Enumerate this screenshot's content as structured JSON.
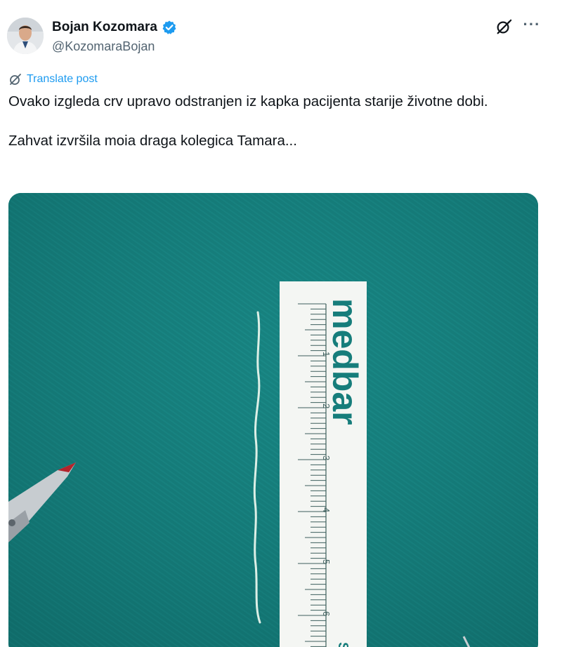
{
  "author": {
    "display_name": "Bojan Kozomara",
    "handle": "@KozomaraBojan",
    "verified": true,
    "verified_color": "#1d9bf0",
    "avatar_icon": "avatar-photo"
  },
  "actions": {
    "grok_icon": "grok-icon",
    "more_label": "···"
  },
  "translate": {
    "label": "Translate post",
    "color": "#1d9bf0"
  },
  "post": {
    "line1": "Ovako izgleda crv upravo odstranjen iz kapka pacijenta starije životne dobi.",
    "line2": "Zahvat izvršila moia draga kolegica Tamara..."
  },
  "media": {
    "ruler_brand": "medbar",
    "ruler_numbers": [
      "1",
      "2",
      "3",
      "4",
      "5",
      "6"
    ],
    "ruler_partial_mark": "S",
    "background_color": "#157c7a"
  }
}
